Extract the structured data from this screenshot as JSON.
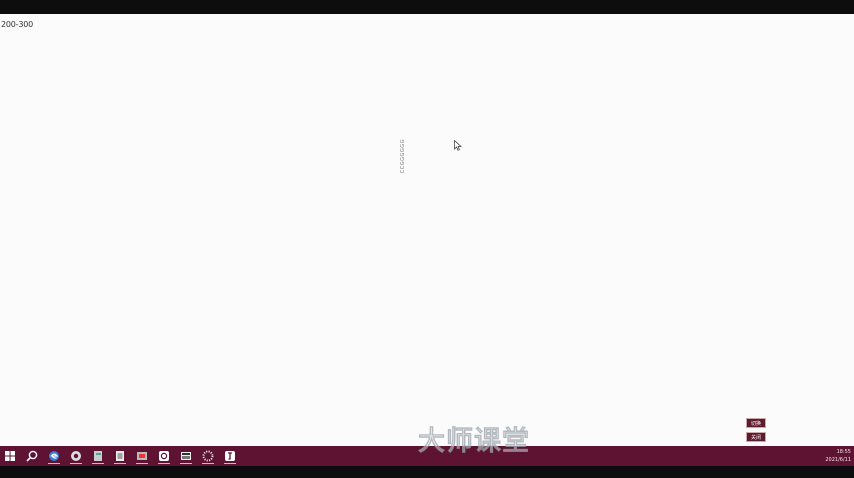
{
  "canvas": {
    "corner_label": "200-300",
    "vertical_text": "CCGGGGGG"
  },
  "side_buttons": [
    {
      "label": "切换"
    },
    {
      "label": "关闭"
    }
  ],
  "taskbar": {
    "items": [
      {
        "name": "start-icon"
      },
      {
        "name": "search-icon"
      },
      {
        "name": "edge-icon"
      },
      {
        "name": "app-icon-1"
      },
      {
        "name": "app-icon-2"
      },
      {
        "name": "app-icon-3"
      },
      {
        "name": "app-icon-4"
      },
      {
        "name": "app-icon-5"
      },
      {
        "name": "app-icon-6"
      },
      {
        "name": "app-icon-7"
      },
      {
        "name": "app-icon-8"
      }
    ],
    "watermark": "大师课堂",
    "clock_time": "18:55",
    "clock_date": "2021/6/11"
  },
  "colors": {
    "taskbar": "#5d1331",
    "canvas": "#fcfbfb",
    "frame": "#0d0d0d"
  }
}
